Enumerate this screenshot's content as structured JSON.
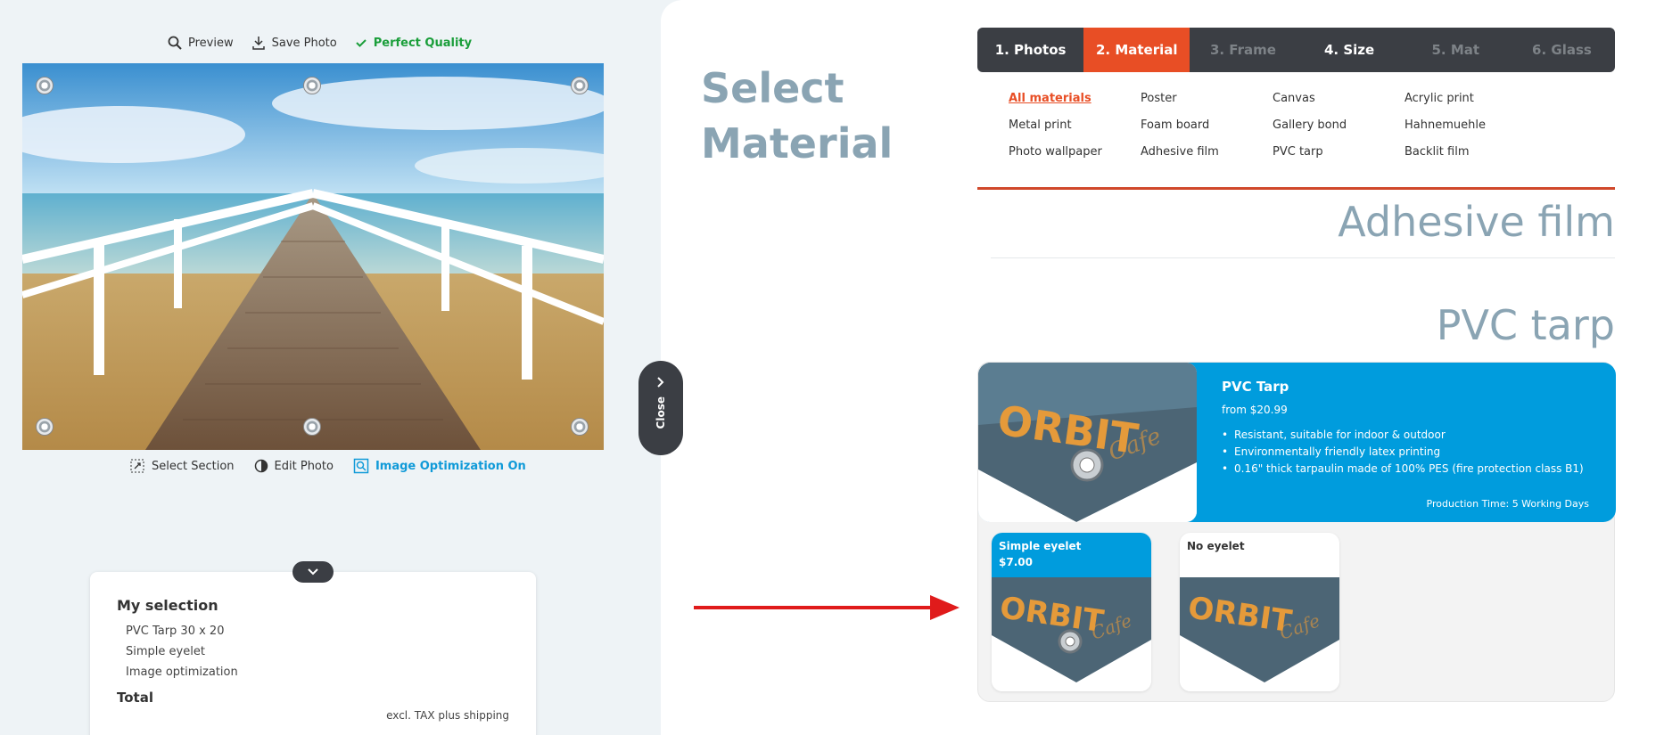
{
  "toolbar_top": {
    "preview": "Preview",
    "save_photo": "Save Photo",
    "quality": "Perfect Quality"
  },
  "toolbar_bottom": {
    "select_section": "Select Section",
    "edit_photo": "Edit Photo",
    "image_optimization": "Image Optimization On"
  },
  "selection": {
    "title": "My selection",
    "items": [
      "PVC Tarp 30 x 20",
      "Simple eyelet",
      "Image optimization"
    ],
    "total_label": "Total",
    "tax_note": "excl. TAX plus shipping"
  },
  "close_tab": {
    "label": "Close"
  },
  "section_title": {
    "line1": "Select",
    "line2": "Material"
  },
  "steps": [
    {
      "label": "1. Photos",
      "state": "done"
    },
    {
      "label": "2. Material",
      "state": "active"
    },
    {
      "label": "3. Frame",
      "state": "disabled"
    },
    {
      "label": "4. Size",
      "state": "done"
    },
    {
      "label": "5. Mat",
      "state": "disabled"
    },
    {
      "label": "6. Glass",
      "state": "disabled"
    }
  ],
  "materials": [
    "All materials",
    "Poster",
    "Canvas",
    "Acrylic print",
    "Metal print",
    "Foam board",
    "Gallery bond",
    "Hahnemuehle",
    "Photo wallpaper",
    "Adhesive film",
    "PVC tarp",
    "Backlit film"
  ],
  "selected_material": "All materials",
  "headings": {
    "adhesive": "Adhesive film",
    "pvc": "PVC tarp"
  },
  "pvc_card": {
    "title": "PVC Tarp",
    "price": "from $20.99",
    "features": [
      "Resistant, suitable for indoor & outdoor",
      "Environmentally friendly latex printing",
      "0.16\" thick tarpaulin made of 100% PES (fire protection class B1)"
    ],
    "production": "Production Time: 5 Working Days"
  },
  "options": [
    {
      "name": "Simple eyelet",
      "price": "$7.00",
      "selected": true
    },
    {
      "name": "No eyelet",
      "price": "",
      "selected": false
    }
  ],
  "colors": {
    "accent": "#e84e25",
    "blue": "#009cdd",
    "dark": "#3b3e44",
    "heading": "#8aa4b3",
    "ok_green": "#1a9e3a"
  }
}
